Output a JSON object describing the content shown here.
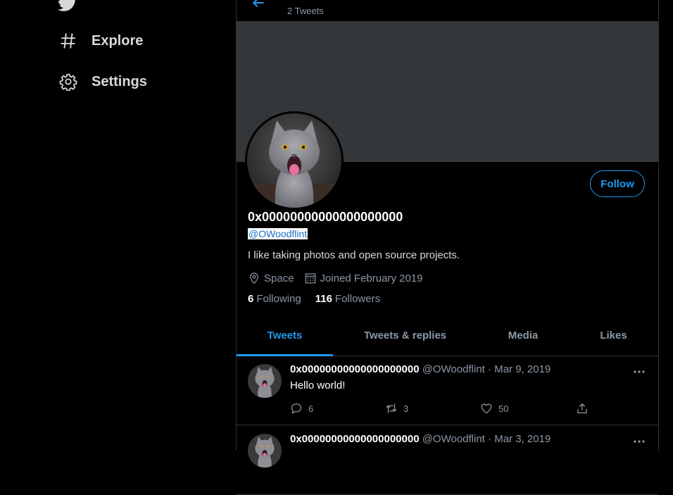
{
  "sidebar": {
    "logo_icon": "twitter-bird-icon",
    "items": [
      {
        "label": "Explore",
        "icon": "hashtag-icon"
      },
      {
        "label": "Settings",
        "icon": "gear-icon"
      }
    ]
  },
  "header": {
    "back_icon": "arrow-left-icon",
    "tweet_count": "2 Tweets"
  },
  "profile": {
    "display_name": "0x00000000000000000000",
    "handle": "@OWoodflint",
    "follow_label": "Follow",
    "bio": "I like taking photos and open source projects.",
    "location": "Space",
    "joined": "Joined February 2019",
    "following_count": "6",
    "following_label": "Following",
    "followers_count": "116",
    "followers_label": "Followers"
  },
  "tabs": [
    {
      "label": "Tweets",
      "active": true
    },
    {
      "label": "Tweets & replies",
      "active": false
    },
    {
      "label": "Media",
      "active": false
    },
    {
      "label": "Likes",
      "active": false
    }
  ],
  "tweets": [
    {
      "name": "0x00000000000000000000",
      "handle": "@OWoodflint",
      "dot": "·",
      "date": "Mar 9, 2019",
      "text": "Hello world!",
      "replies": "6",
      "retweets": "3",
      "likes": "50"
    },
    {
      "name": "0x00000000000000000000",
      "handle": "@OWoodflint",
      "dot": "·",
      "date": "Mar 3, 2019",
      "text": "",
      "replies": "",
      "retweets": "",
      "likes": ""
    }
  ],
  "colors": {
    "accent": "#1d9bf0",
    "background": "#000000",
    "banner": "#33373a",
    "muted_text": "#8b98a5"
  }
}
